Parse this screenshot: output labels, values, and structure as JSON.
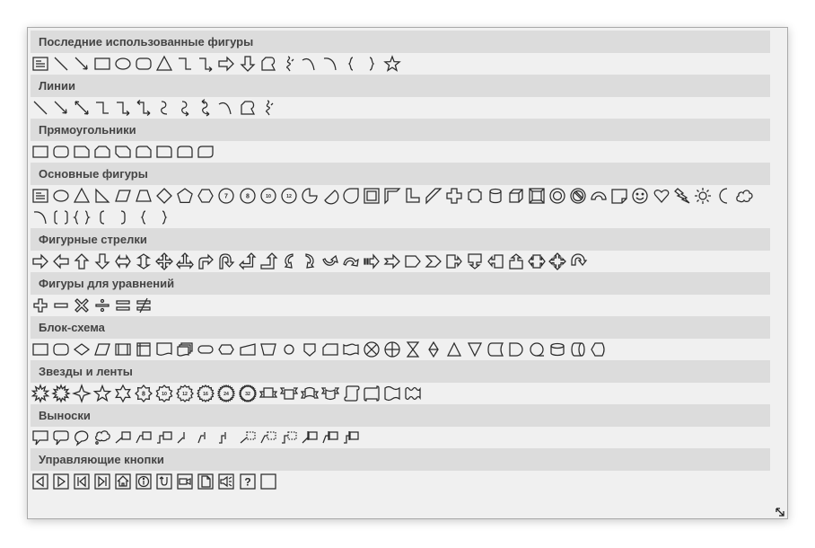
{
  "sections": [
    {
      "title": "Последние использованные фигуры",
      "rows": [
        [
          {
            "icon": "text-box-icon"
          },
          {
            "icon": "line-icon"
          },
          {
            "icon": "arrow-line-icon"
          },
          {
            "icon": "rectangle-icon"
          },
          {
            "icon": "oval-icon"
          },
          {
            "icon": "rounded-rectangle-icon"
          },
          {
            "icon": "triangle-icon"
          },
          {
            "icon": "elbow-connector-icon"
          },
          {
            "icon": "elbow-arrow-connector-icon"
          },
          {
            "icon": "right-arrow-icon"
          },
          {
            "icon": "down-arrow-icon"
          },
          {
            "icon": "freeform-icon"
          },
          {
            "icon": "scribble-icon"
          },
          {
            "icon": "curve-icon"
          },
          {
            "icon": "arc-icon"
          },
          {
            "icon": "left-brace-icon"
          },
          {
            "icon": "right-brace-icon"
          },
          {
            "icon": "star-icon"
          }
        ]
      ]
    },
    {
      "title": "Линии",
      "rows": [
        [
          {
            "icon": "line-icon"
          },
          {
            "icon": "arrow-line-icon"
          },
          {
            "icon": "double-arrow-line-icon"
          },
          {
            "icon": "elbow-connector-icon"
          },
          {
            "icon": "elbow-arrow-connector-icon"
          },
          {
            "icon": "elbow-double-arrow-connector-icon"
          },
          {
            "icon": "curved-connector-icon"
          },
          {
            "icon": "curved-arrow-connector-icon"
          },
          {
            "icon": "curved-double-arrow-connector-icon"
          },
          {
            "icon": "curve-icon"
          },
          {
            "icon": "freeform-icon"
          },
          {
            "icon": "scribble-icon"
          }
        ]
      ]
    },
    {
      "title": "Прямоугольники",
      "rows": [
        [
          {
            "icon": "rectangle-icon"
          },
          {
            "icon": "rounded-rectangle-icon"
          },
          {
            "icon": "snip-corner-rectangle-icon"
          },
          {
            "icon": "snip-same-side-rectangle-icon"
          },
          {
            "icon": "snip-diagonal-rectangle-icon"
          },
          {
            "icon": "snip-round-rectangle-icon"
          },
          {
            "icon": "round-corner-rectangle-icon"
          },
          {
            "icon": "round-same-side-rectangle-icon"
          },
          {
            "icon": "round-diagonal-rectangle-icon"
          }
        ]
      ]
    },
    {
      "title": "Основные фигуры",
      "rows": [
        [
          {
            "icon": "text-box-icon"
          },
          {
            "icon": "oval-icon"
          },
          {
            "icon": "triangle-icon"
          },
          {
            "icon": "right-triangle-icon"
          },
          {
            "icon": "parallelogram-icon"
          },
          {
            "icon": "trapezoid-icon"
          },
          {
            "icon": "diamond-icon"
          },
          {
            "icon": "pentagon-icon"
          },
          {
            "icon": "hexagon-icon"
          },
          {
            "icon": "heptagon-icon",
            "label": "7"
          },
          {
            "icon": "octagon-icon",
            "label": "8"
          },
          {
            "icon": "decagon-icon",
            "label": "10"
          },
          {
            "icon": "dodecagon-icon",
            "label": "12"
          },
          {
            "icon": "pie-icon"
          },
          {
            "icon": "chord-icon"
          },
          {
            "icon": "teardrop-icon"
          },
          {
            "icon": "frame-icon"
          },
          {
            "icon": "half-frame-icon"
          },
          {
            "icon": "l-shape-icon"
          },
          {
            "icon": "diagonal-stripe-icon"
          },
          {
            "icon": "cross-icon"
          },
          {
            "icon": "plaque-icon"
          },
          {
            "icon": "can-icon"
          },
          {
            "icon": "cube-icon"
          },
          {
            "icon": "bevel-icon"
          },
          {
            "icon": "donut-icon"
          },
          {
            "icon": "no-symbol-icon"
          },
          {
            "icon": "block-arc-icon"
          },
          {
            "icon": "folded-corner-icon"
          },
          {
            "icon": "smiley-face-icon"
          },
          {
            "icon": "heart-icon"
          },
          {
            "icon": "lightning-bolt-icon"
          },
          {
            "icon": "sun-icon"
          },
          {
            "icon": "moon-icon"
          },
          {
            "icon": "cloud-icon"
          }
        ],
        [
          {
            "icon": "arc-icon"
          },
          {
            "icon": "double-bracket-icon"
          },
          {
            "icon": "double-brace-icon"
          },
          {
            "icon": "left-bracket-icon"
          },
          {
            "icon": "right-bracket-icon"
          },
          {
            "icon": "left-brace-icon"
          },
          {
            "icon": "right-brace-icon"
          }
        ]
      ]
    },
    {
      "title": "Фигурные стрелки",
      "rows": [
        [
          {
            "icon": "right-arrow-icon"
          },
          {
            "icon": "left-arrow-icon"
          },
          {
            "icon": "up-arrow-icon"
          },
          {
            "icon": "down-arrow-icon"
          },
          {
            "icon": "left-right-arrow-icon"
          },
          {
            "icon": "up-down-arrow-icon"
          },
          {
            "icon": "quad-arrow-icon"
          },
          {
            "icon": "left-right-up-arrow-icon"
          },
          {
            "icon": "bent-arrow-icon"
          },
          {
            "icon": "u-turn-arrow-icon"
          },
          {
            "icon": "left-up-arrow-icon"
          },
          {
            "icon": "bent-up-arrow-icon"
          },
          {
            "icon": "curved-right-arrow-icon"
          },
          {
            "icon": "curved-left-arrow-icon"
          },
          {
            "icon": "curved-up-arrow-icon"
          },
          {
            "icon": "curved-down-arrow-icon"
          },
          {
            "icon": "striped-right-arrow-icon"
          },
          {
            "icon": "notched-right-arrow-icon"
          },
          {
            "icon": "pentagon-arrow-icon"
          },
          {
            "icon": "chevron-icon"
          },
          {
            "icon": "right-arrow-callout-icon"
          },
          {
            "icon": "down-arrow-callout-icon"
          },
          {
            "icon": "left-arrow-callout-icon"
          },
          {
            "icon": "up-arrow-callout-icon"
          },
          {
            "icon": "left-right-arrow-callout-icon"
          },
          {
            "icon": "quad-arrow-callout-icon"
          },
          {
            "icon": "circular-arrow-icon"
          }
        ]
      ]
    },
    {
      "title": "Фигуры для уравнений",
      "rows": [
        [
          {
            "icon": "plus-icon"
          },
          {
            "icon": "minus-icon"
          },
          {
            "icon": "multiply-icon"
          },
          {
            "icon": "division-icon"
          },
          {
            "icon": "equal-icon"
          },
          {
            "icon": "not-equal-icon"
          }
        ]
      ]
    },
    {
      "title": "Блок-схема",
      "rows": [
        [
          {
            "icon": "flowchart-process-icon"
          },
          {
            "icon": "flowchart-alternate-process-icon"
          },
          {
            "icon": "flowchart-decision-icon"
          },
          {
            "icon": "flowchart-data-icon"
          },
          {
            "icon": "flowchart-predefined-process-icon"
          },
          {
            "icon": "flowchart-internal-storage-icon"
          },
          {
            "icon": "flowchart-document-icon"
          },
          {
            "icon": "flowchart-multidocument-icon"
          },
          {
            "icon": "flowchart-terminator-icon"
          },
          {
            "icon": "flowchart-preparation-icon"
          },
          {
            "icon": "flowchart-manual-input-icon"
          },
          {
            "icon": "flowchart-manual-operation-icon"
          },
          {
            "icon": "flowchart-connector-icon"
          },
          {
            "icon": "flowchart-off-page-connector-icon"
          },
          {
            "icon": "flowchart-card-icon"
          },
          {
            "icon": "flowchart-punched-tape-icon"
          },
          {
            "icon": "flowchart-summing-junction-icon"
          },
          {
            "icon": "flowchart-or-icon"
          },
          {
            "icon": "flowchart-collate-icon"
          },
          {
            "icon": "flowchart-sort-icon"
          },
          {
            "icon": "flowchart-extract-icon"
          },
          {
            "icon": "flowchart-merge-icon"
          },
          {
            "icon": "flowchart-stored-data-icon"
          },
          {
            "icon": "flowchart-delay-icon"
          },
          {
            "icon": "flowchart-sequential-access-icon"
          },
          {
            "icon": "flowchart-magnetic-disk-icon"
          },
          {
            "icon": "flowchart-direct-access-icon"
          },
          {
            "icon": "flowchart-display-icon"
          }
        ]
      ]
    },
    {
      "title": "Звезды и ленты",
      "rows": [
        [
          {
            "icon": "explosion-1-icon"
          },
          {
            "icon": "explosion-2-icon"
          },
          {
            "icon": "star-4-point-icon"
          },
          {
            "icon": "star-5-point-icon"
          },
          {
            "icon": "star-6-point-icon"
          },
          {
            "icon": "star-8-point-icon",
            "label": "8"
          },
          {
            "icon": "star-10-point-icon",
            "label": "10"
          },
          {
            "icon": "star-12-point-icon",
            "label": "12"
          },
          {
            "icon": "star-16-point-icon",
            "label": "16"
          },
          {
            "icon": "star-24-point-icon",
            "label": "24"
          },
          {
            "icon": "star-32-point-icon",
            "label": "32"
          },
          {
            "icon": "ribbon-up-icon"
          },
          {
            "icon": "ribbon-down-icon"
          },
          {
            "icon": "curved-ribbon-up-icon"
          },
          {
            "icon": "curved-ribbon-down-icon"
          },
          {
            "icon": "vertical-scroll-icon"
          },
          {
            "icon": "horizontal-scroll-icon"
          },
          {
            "icon": "wave-icon"
          },
          {
            "icon": "double-wave-icon"
          }
        ]
      ]
    },
    {
      "title": "Выноски",
      "rows": [
        [
          {
            "icon": "rectangular-callout-icon"
          },
          {
            "icon": "rounded-rectangular-callout-icon"
          },
          {
            "icon": "oval-callout-icon"
          },
          {
            "icon": "cloud-callout-icon"
          },
          {
            "icon": "line-callout-1-icon"
          },
          {
            "icon": "line-callout-2-icon"
          },
          {
            "icon": "line-callout-3-icon"
          },
          {
            "icon": "line-callout-1-accent-bar-icon"
          },
          {
            "icon": "line-callout-2-accent-bar-icon"
          },
          {
            "icon": "line-callout-3-accent-bar-icon"
          },
          {
            "icon": "line-callout-1-no-border-icon"
          },
          {
            "icon": "line-callout-2-no-border-icon"
          },
          {
            "icon": "line-callout-3-no-border-icon"
          },
          {
            "icon": "line-callout-1-border-accent-icon"
          },
          {
            "icon": "line-callout-2-border-accent-icon"
          },
          {
            "icon": "line-callout-3-border-accent-icon"
          }
        ]
      ]
    },
    {
      "title": "Управляющие кнопки",
      "rows": [
        [
          {
            "icon": "action-back-icon"
          },
          {
            "icon": "action-forward-icon"
          },
          {
            "icon": "action-beginning-icon"
          },
          {
            "icon": "action-end-icon"
          },
          {
            "icon": "action-home-icon"
          },
          {
            "icon": "action-information-icon"
          },
          {
            "icon": "action-return-icon"
          },
          {
            "icon": "action-movie-icon"
          },
          {
            "icon": "action-document-icon"
          },
          {
            "icon": "action-sound-icon"
          },
          {
            "icon": "action-help-icon",
            "label": "?"
          },
          {
            "icon": "action-custom-icon"
          }
        ]
      ]
    }
  ]
}
